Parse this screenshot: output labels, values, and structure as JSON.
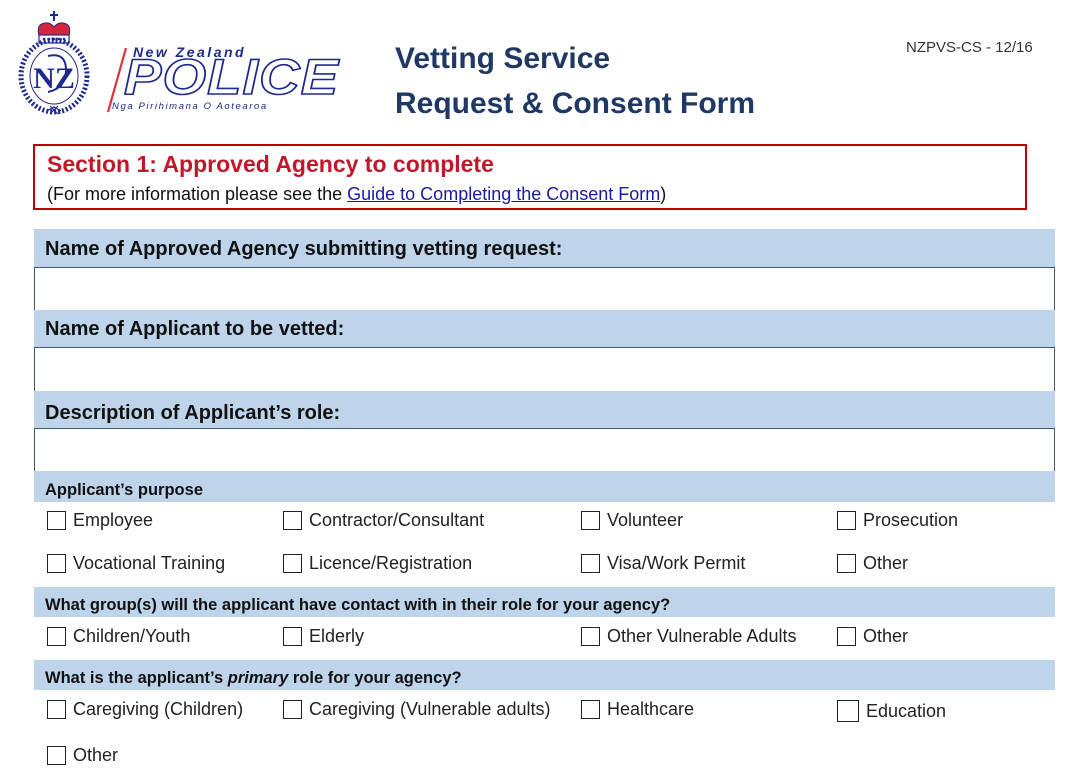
{
  "logo": {
    "country": "New Zealand",
    "name": "POLICE",
    "subtitle": "Nga Pirihimana O Aotearoa"
  },
  "header": {
    "title_line1": "Vetting Service",
    "title_line2": "Request & Consent Form",
    "form_code": "NZPVS-CS - 12/16"
  },
  "section": {
    "title": "Section 1:  Approved Agency to complete",
    "info_prefix": "(For more information please see the ",
    "info_link": "Guide to Completing the Consent Form",
    "info_suffix": ")"
  },
  "fields": [
    {
      "label": "Name of Approved Agency submitting vetting request:",
      "value": "",
      "placeholder": ""
    },
    {
      "label": "Name of Applicant to be vetted:",
      "value": "",
      "placeholder": ""
    },
    {
      "label": "Description of Applicant’s role:",
      "value": "",
      "placeholder": ""
    }
  ],
  "purpose": {
    "heading": "Applicant’s purpose",
    "options": [
      {
        "label": "Employee",
        "checked": false
      },
      {
        "label": "Contractor/Consultant",
        "checked": false
      },
      {
        "label": "Volunteer",
        "checked": false
      },
      {
        "label": "Prosecution",
        "checked": false
      },
      {
        "label": "Vocational Training",
        "checked": false
      },
      {
        "label": "Licence/Registration",
        "checked": false
      },
      {
        "label": "Visa/Work Permit",
        "checked": false
      },
      {
        "label": "Other",
        "checked": false
      }
    ]
  },
  "groups": {
    "heading": "What group(s) will the applicant have contact with in their role for your agency?",
    "options": [
      {
        "label": "Children/Youth",
        "checked": false
      },
      {
        "label": "Elderly",
        "checked": false
      },
      {
        "label": "Other Vulnerable Adults",
        "checked": false
      },
      {
        "label": "Other",
        "checked": false
      }
    ]
  },
  "primary_role": {
    "heading_prefix": "What is the applicant’s ",
    "heading_emphasis": "primary",
    "heading_suffix": " role for your agency?",
    "options": [
      {
        "label": "Caregiving (Children)",
        "checked": false
      },
      {
        "label": "Caregiving (Vulnerable adults)",
        "checked": false
      },
      {
        "label": "Healthcare",
        "checked": false
      },
      {
        "label": "Education",
        "checked": false
      },
      {
        "label": "Other",
        "checked": false
      }
    ]
  },
  "colors": {
    "title_navy": "#1f3864",
    "section_red": "#c00000",
    "bar_blue": "#bdd4ea",
    "link_blue": "#1a1aa6",
    "logo_blue": "#1e2a8a"
  }
}
